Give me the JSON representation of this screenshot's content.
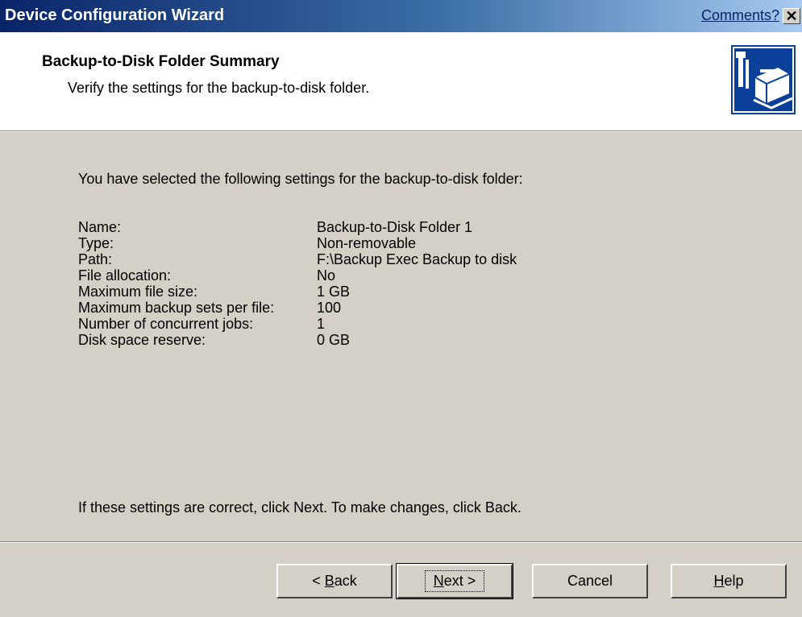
{
  "window": {
    "title": "Device Configuration Wizard",
    "comments_link": "Comments?",
    "close_glyph": "✕"
  },
  "header": {
    "title": "Backup-to-Disk Folder Summary",
    "subtitle": "Verify the settings for the backup-to-disk folder.",
    "icon": "device-wizard-icon"
  },
  "body": {
    "intro": "You have selected the following settings for the backup-to-disk folder:",
    "settings": [
      {
        "label": "Name:",
        "value": "Backup-to-Disk Folder 1"
      },
      {
        "label": "Type:",
        "value": "Non-removable"
      },
      {
        "label": "Path:",
        "value": "F:\\Backup Exec Backup to disk"
      },
      {
        "label": "File allocation:",
        "value": "No"
      },
      {
        "label": "Maximum file size:",
        "value": "1 GB"
      },
      {
        "label": "Maximum backup sets per file:",
        "value": "100"
      },
      {
        "label": "Number of concurrent jobs:",
        "value": "1"
      },
      {
        "label": "Disk space reserve:",
        "value": "0 GB"
      }
    ],
    "footer": "If these settings are correct, click Next.  To make changes, click Back."
  },
  "buttons": {
    "back": {
      "prefix": "< ",
      "mnemonic": "B",
      "rest": "ack"
    },
    "next": {
      "mnemonic": "N",
      "rest": "ext >"
    },
    "cancel": "Cancel",
    "help": {
      "mnemonic": "H",
      "rest": "elp"
    }
  },
  "colors": {
    "titlebar_start": "#0a246a",
    "titlebar_end": "#a6caf0",
    "face": "#d4d0c8",
    "icon_bg": "#0a3f9a"
  }
}
